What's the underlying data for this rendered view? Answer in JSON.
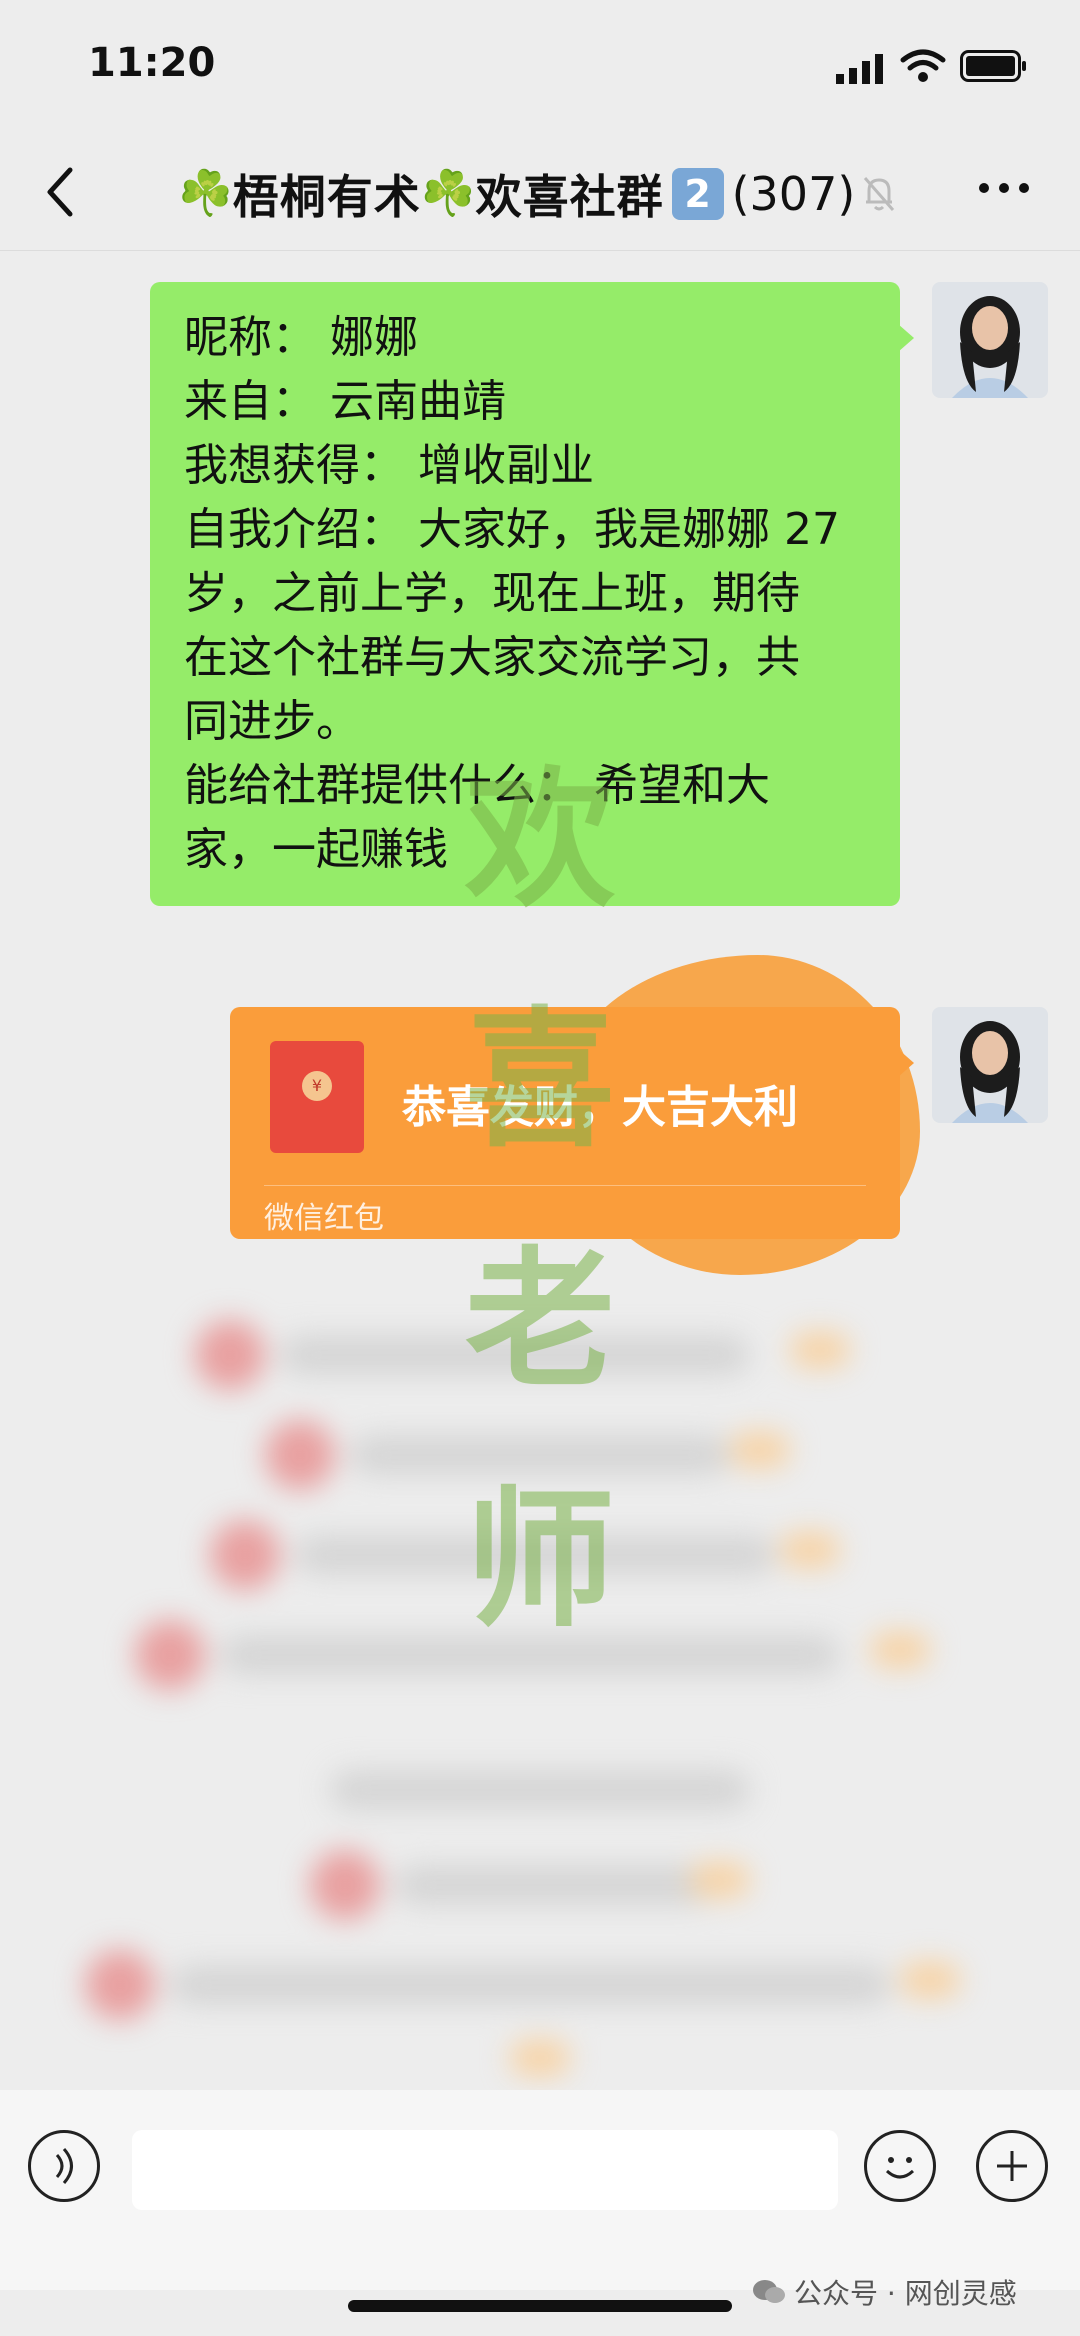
{
  "status_bar": {
    "time": "11:20"
  },
  "header": {
    "title_prefix_icon": "☘️",
    "title_name": "梧桐有术",
    "title_mid_icon": "☘️",
    "title_suffix": "欢喜社群",
    "title_number": "2",
    "member_count": "(307)",
    "back_icon": "chevron-left-icon",
    "mute_icon": "bell-off-icon",
    "more_icon": "more-horizontal-icon"
  },
  "messages": {
    "intro": {
      "lines": [
        "昵称：  娜娜",
        "来自：  云南曲靖",
        "我想获得：  增收副业",
        "自我介绍：  大家好，我是娜娜 27",
        "岁，之前上学，现在上班，期待",
        "在这个社群与大家交流学习，共",
        "同进步。",
        "能给社群提供什么：  希望和大",
        "家，一起赚钱"
      ]
    },
    "red_packet": {
      "greeting": "恭喜发财，大吉大利",
      "label": "微信红包",
      "icon": "red-envelope-icon"
    }
  },
  "watermark": {
    "chars": [
      "欢",
      "喜",
      "老",
      "师"
    ]
  },
  "footer": {
    "source_mark": "公众号 · 网创灵感"
  },
  "colors": {
    "bubble_green": "#95ec69",
    "red_packet_orange": "#fa9d3b",
    "background": "#ededed"
  }
}
